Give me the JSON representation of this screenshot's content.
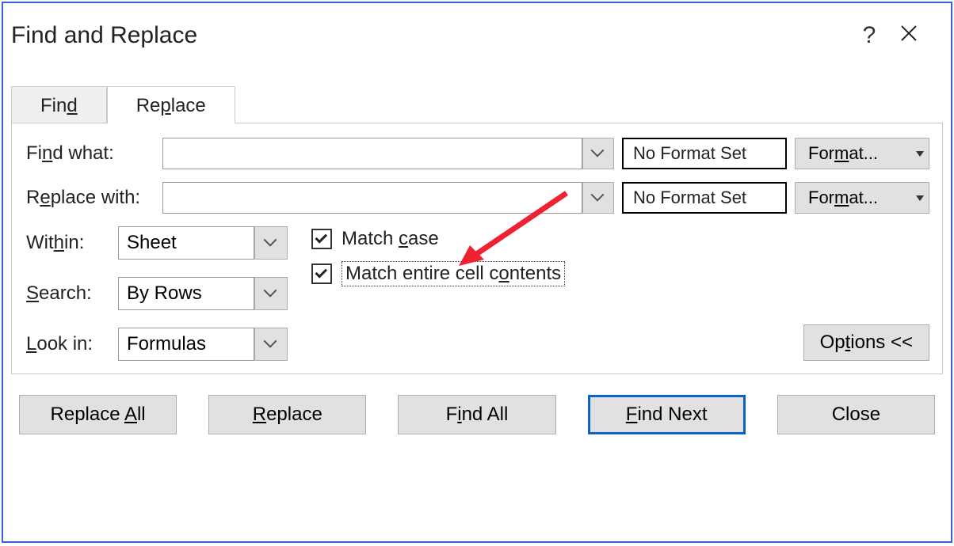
{
  "title": "Find and Replace",
  "tabs": {
    "find": {
      "prefix": "Fin",
      "ul": "d",
      "suffix": ""
    },
    "replace": {
      "prefix": "Re",
      "ul": "p",
      "suffix": "lace"
    }
  },
  "labels": {
    "find_what": {
      "prefix": "Fi",
      "ul": "n",
      "suffix": "d what:"
    },
    "replace_with": {
      "prefix": "R",
      "ul": "e",
      "suffix": "place with:"
    },
    "within": {
      "prefix": "Wit",
      "ul": "h",
      "suffix": "in:"
    },
    "search": {
      "ul": "S",
      "suffix": "earch:"
    },
    "look_in": {
      "ul": "L",
      "suffix": "ook in:"
    }
  },
  "fields": {
    "find_what": "",
    "replace_with": "",
    "within": "Sheet",
    "search": "By Rows",
    "look_in": "Formulas"
  },
  "format": {
    "find_status": "No Format Set",
    "replace_status": "No Format Set",
    "button": {
      "prefix": "For",
      "ul": "m",
      "suffix": "at..."
    }
  },
  "checks": {
    "match_case": {
      "prefix": "Match ",
      "ul": "c",
      "suffix": "ase",
      "checked": true
    },
    "match_entire": {
      "prefix": "Match entire cell c",
      "ul": "o",
      "suffix": "ntents",
      "checked": true
    }
  },
  "options_btn": {
    "prefix": "Op",
    "ul": "t",
    "suffix": "ions <<"
  },
  "buttons": {
    "replace_all": {
      "prefix": "Replace ",
      "ul": "A",
      "suffix": "ll"
    },
    "replace": {
      "ul": "R",
      "suffix": "eplace"
    },
    "find_all": {
      "prefix": "F",
      "ul": "i",
      "suffix": "nd All"
    },
    "find_next": {
      "ul": "F",
      "suffix": "ind Next"
    },
    "close": {
      "text": "Close"
    }
  }
}
